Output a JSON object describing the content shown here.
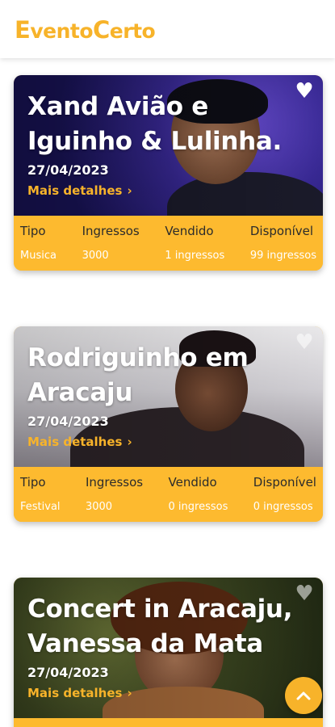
{
  "app": {
    "logo_part1": "E",
    "logo_part2": "vento",
    "logo_part3": "C",
    "logo_part4": "erto"
  },
  "colors": {
    "accent": "#F7B32A",
    "info_bar": "#FDBA2F"
  },
  "info_labels": {
    "tipo": "Tipo",
    "ingressos": "Ingressos",
    "vendido": "Vendido",
    "disponivel": "Disponível"
  },
  "events": [
    {
      "title": "Xand Avião e Iguinho & Lulinha.",
      "date": "27/04/2023",
      "more": "Mais detalhes",
      "tipo": "Musica",
      "ingressos": "3000",
      "vendido": "1 ingressos",
      "disponivel": "99 ingressos"
    },
    {
      "title": "Rodriguinho em Aracaju",
      "date": "27/04/2023",
      "more": "Mais detalhes",
      "tipo": "Festival",
      "ingressos": "3000",
      "vendido": "0 ingressos",
      "disponivel": "0 ingressos"
    },
    {
      "title": "Concert in Aracaju, Vanessa da Mata",
      "date": "27/04/2023",
      "more": "Mais detalhes"
    }
  ],
  "icons": {
    "favorite": "heart-icon",
    "more": "chevron-right-icon",
    "scroll_top": "chevron-up-icon"
  }
}
